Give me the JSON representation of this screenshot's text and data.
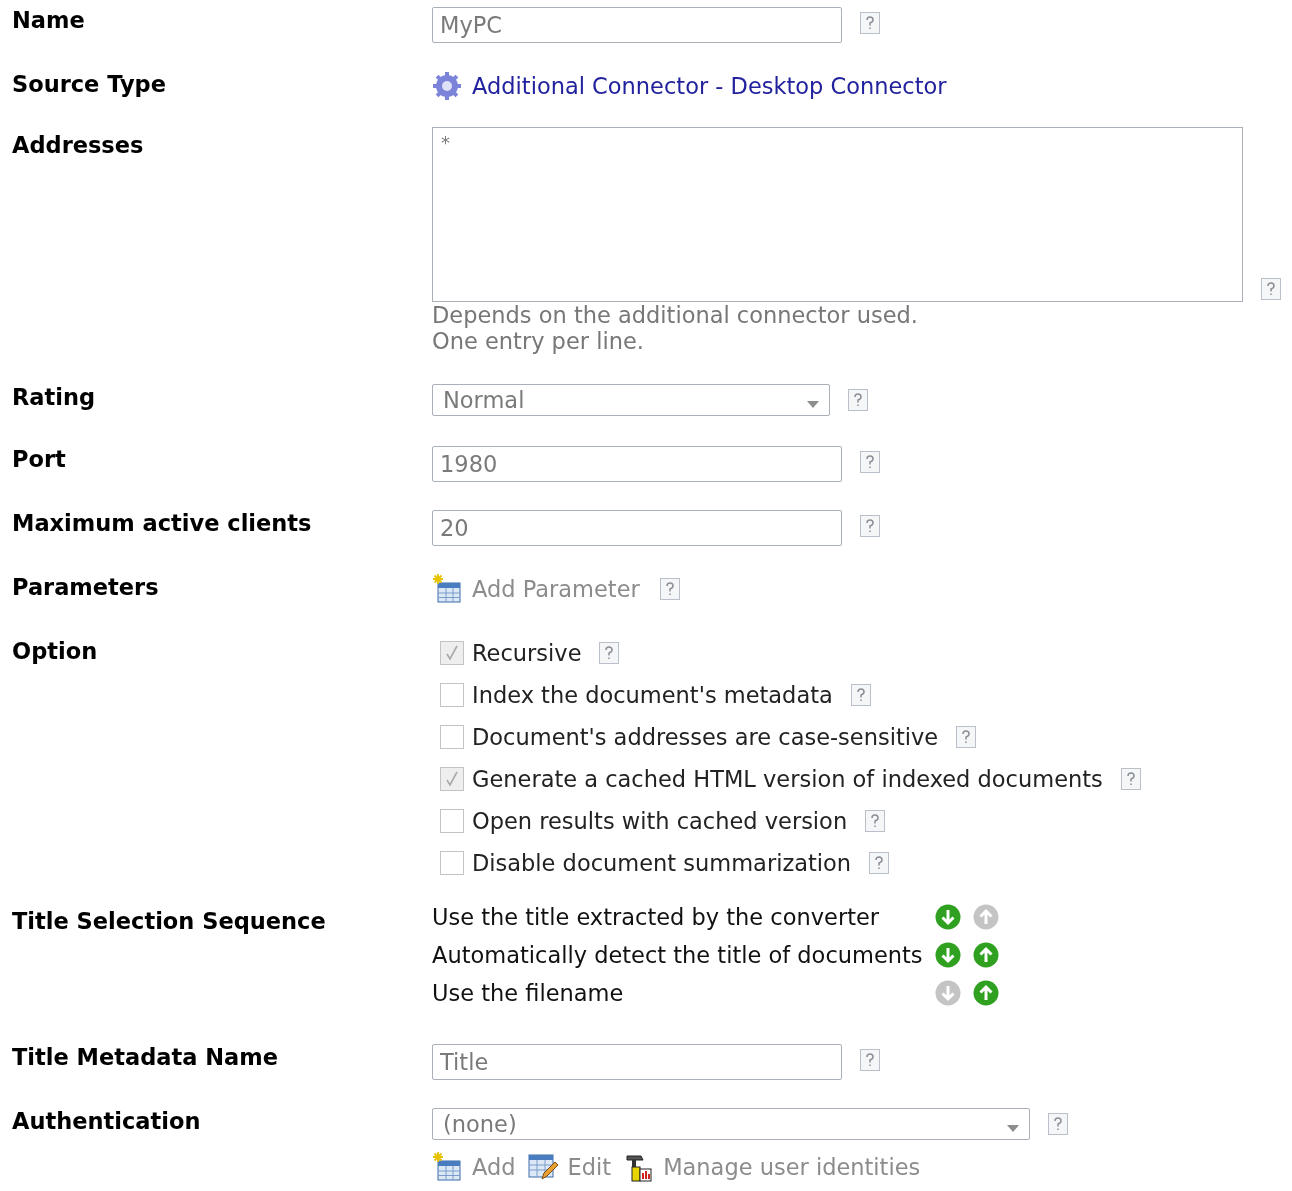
{
  "fields": [
    {
      "label": "Name",
      "kind": "input",
      "value": "MyPC",
      "help": true
    },
    {
      "label": "Source Type",
      "kind": "link",
      "text": "Additional Connector - Desktop Connector",
      "help": false
    },
    {
      "label": "Addresses",
      "kind": "textarea",
      "value": "*",
      "notes": [
        "Depends on the additional connector used.",
        "One entry per line."
      ],
      "help": true
    },
    {
      "label": "Rating",
      "kind": "select",
      "value": "Normal",
      "help": true
    },
    {
      "label": "Port",
      "kind": "input",
      "value": "1980",
      "help": true
    },
    {
      "label": "Maximum active clients",
      "kind": "input",
      "value": "20",
      "help": true
    },
    {
      "label": "Parameters",
      "kind": "actions",
      "actions": [
        {
          "kind": "add",
          "text": "Add Parameter"
        }
      ],
      "help": true
    },
    {
      "label": "Option",
      "kind": "checkboxes",
      "help": false,
      "items": [
        {
          "text": "Recursive",
          "checked": true
        },
        {
          "text": "Index the document's metadata",
          "checked": false
        },
        {
          "text": "Document's addresses are case-sensitive",
          "checked": false
        },
        {
          "text": "Generate a cached HTML version of indexed documents",
          "checked": true
        },
        {
          "text": "Open results with cached version",
          "checked": false
        },
        {
          "text": "Disable document summarization",
          "checked": false
        }
      ]
    },
    {
      "label": "Title Selection Sequence",
      "kind": "sequence",
      "help": false,
      "items": [
        {
          "text": "Use the title extracted by the converter",
          "down_disabled": false,
          "up_disabled": true
        },
        {
          "text": "Automatically detect the title of documents",
          "down_disabled": false,
          "up_disabled": false
        },
        {
          "text": "Use the filename",
          "down_disabled": true,
          "up_disabled": false
        }
      ]
    },
    {
      "label": "Title Metadata Name",
      "kind": "input",
      "value": "Title",
      "help": true
    },
    {
      "label": "Authentication",
      "kind": "select",
      "value": "(none)",
      "help": true,
      "actions": [
        {
          "kind": "add",
          "text": "Add"
        },
        {
          "kind": "edit",
          "text": "Edit"
        },
        {
          "kind": "manage",
          "text": "Manage user identities"
        }
      ]
    }
  ]
}
